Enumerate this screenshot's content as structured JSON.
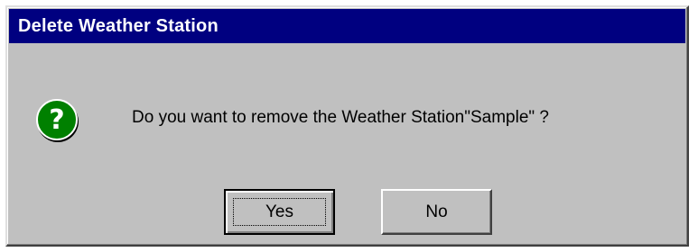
{
  "dialog": {
    "title": "Delete Weather Station",
    "message": "Do you want to remove the Weather Station\"Sample\" ?",
    "icon": "question-icon",
    "buttons": {
      "yes": "Yes",
      "no": "No"
    }
  },
  "colors": {
    "titlebar": "#000080",
    "face": "#c0c0c0",
    "icon_fill": "#008000"
  }
}
